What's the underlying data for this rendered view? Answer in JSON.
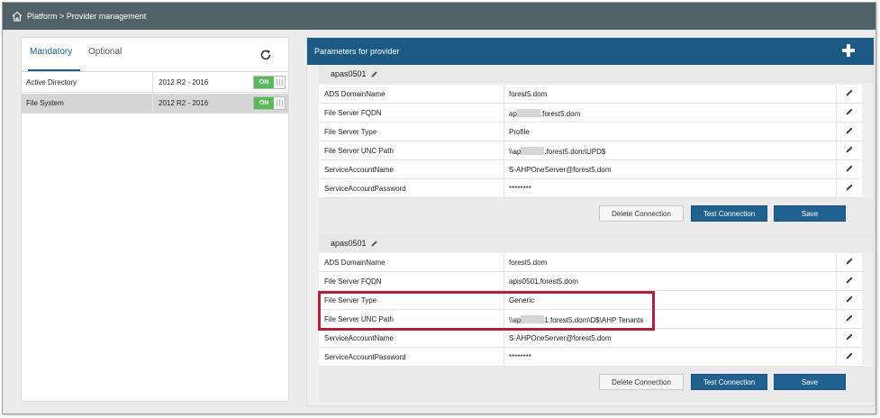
{
  "breadcrumb": "Platform > Provider management",
  "tabs": {
    "mandatory": "Mandatory",
    "optional": "Optional"
  },
  "providers": [
    {
      "name": "Active Directory",
      "version": "2012 R2 - 2016",
      "toggle": "ON"
    },
    {
      "name": "File System",
      "version": "2012 R2 - 2016",
      "toggle": "ON"
    }
  ],
  "params_header": "Parameters for provider",
  "sections": [
    {
      "name": "apas0501",
      "rows": [
        {
          "key": "ADS DomainName",
          "value": "forest5.dom"
        },
        {
          "key": "File Server FQDN",
          "value_pre": "ap",
          "value_post": ".forest5.dom"
        },
        {
          "key": "File Server Type",
          "value": "Profile"
        },
        {
          "key": "File Server UNC Path",
          "value_pre": "\\\\ap",
          "value_post": ".forest5.dom\\UPD$"
        },
        {
          "key": "ServiceAccountName",
          "value": "S-AHPOneServer@forest5.dom"
        },
        {
          "key": "ServiceAccountPassword",
          "value": "********"
        }
      ],
      "buttons": {
        "delete": "Delete Connection",
        "test": "Test Connection",
        "save": "Save"
      }
    },
    {
      "name": "apas0501",
      "rows": [
        {
          "key": "ADS DomainName",
          "value": "forest5.dom"
        },
        {
          "key": "File Server FQDN",
          "value": "apis0501.forest5.dom"
        },
        {
          "key": "File Server Type",
          "value": "Generic"
        },
        {
          "key": "File Server UNC Path",
          "value_pre": "\\\\ap",
          "value_post": "1.forest5.dom\\D$\\AHP Tenants"
        },
        {
          "key": "ServiceAccountName",
          "value": "S-AHPOneServer@forest5.dom"
        },
        {
          "key": "ServiceAccountPassword",
          "value": "********"
        }
      ],
      "buttons": {
        "delete": "Delete Connection",
        "test": "Test Connection",
        "save": "Save"
      }
    }
  ],
  "colors": {
    "topbar": "#516269",
    "header": "#1b5a84",
    "primary_button": "#21618f",
    "toggle_on": "#5cb85c",
    "highlight_box": "#b0203c"
  },
  "icons": [
    "home-icon",
    "refresh-icon",
    "plus-icon",
    "pencil-icon"
  ]
}
